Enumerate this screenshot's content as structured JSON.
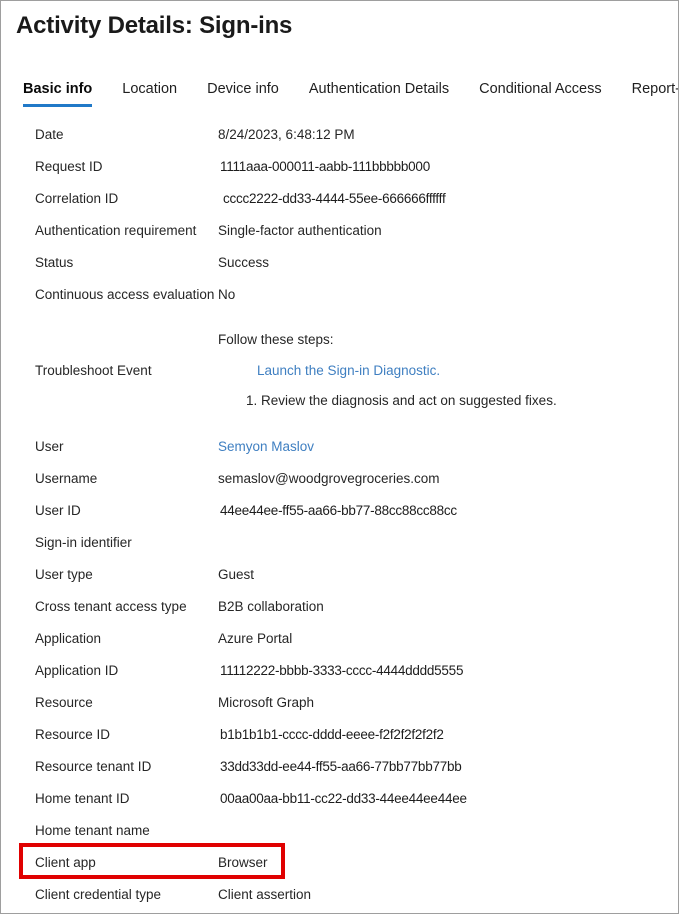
{
  "window": {
    "title": "Activity Details: Sign-ins",
    "border_color": "#9e9e9e"
  },
  "tabs": [
    {
      "label": "Basic info",
      "active": true
    },
    {
      "label": "Location",
      "active": false
    },
    {
      "label": "Device info",
      "active": false
    },
    {
      "label": "Authentication Details",
      "active": false
    },
    {
      "label": "Conditional Access",
      "active": false
    },
    {
      "label": "Report-only",
      "active": false
    }
  ],
  "accent_color": "#2079c8",
  "link_color": "#3f7fc1",
  "highlight_color": "#e00000",
  "basic_info": {
    "rows_group1": [
      {
        "label": "Date",
        "value": "8/24/2023, 6:48:12 PM"
      },
      {
        "label": "Request ID",
        "value": "1111aaa-000011-aabb-111bbbbb000"
      },
      {
        "label": "Correlation ID",
        "value": "cccc2222-dd33-4444-55ee-666666ffffff"
      },
      {
        "label": "Authentication requirement",
        "value": "Single-factor authentication"
      },
      {
        "label": "Status",
        "value": "Success"
      },
      {
        "label": "Continuous access evaluation",
        "value": "No"
      }
    ],
    "troubleshoot": {
      "label": "Troubleshoot Event",
      "steps_heading": "Follow these steps:",
      "link_text": "Launch the Sign-in Diagnostic.",
      "step_one": "1. Review the diagnosis and act on suggested fixes."
    },
    "rows_group2": [
      {
        "label": "User",
        "value": "Semyon Maslov"
      },
      {
        "label": "Username",
        "value": "semaslov@woodgrovegroceries.com"
      },
      {
        "label": "User ID",
        "value": "44ee44ee-ff55-aa66-bb77-88cc88cc88cc"
      },
      {
        "label": "Sign-in identifier",
        "value": ""
      },
      {
        "label": "User type",
        "value": "Guest"
      },
      {
        "label": "Cross tenant access type",
        "value": "B2B collaboration"
      },
      {
        "label": "Application",
        "value": "Azure Portal"
      },
      {
        "label": "Application ID",
        "value": "11112222-bbbb-3333-cccc-4444dddd5555"
      },
      {
        "label": "Resource",
        "value": "Microsoft Graph"
      },
      {
        "label": "Resource ID",
        "value": "b1b1b1b1-cccc-dddd-eeee-f2f2f2f2f2f2"
      },
      {
        "label": "Resource tenant ID",
        "value": "33dd33dd-ee44-ff55-aa66-77bb77bb77bb"
      },
      {
        "label": "Home tenant ID",
        "value": "00aa00aa-bb11-cc22-dd33-44ee44ee44ee"
      },
      {
        "label": "Home tenant name",
        "value": ""
      },
      {
        "label": "Client app",
        "value": "Browser"
      },
      {
        "label": "Client credential type",
        "value": "Client assertion"
      }
    ]
  }
}
